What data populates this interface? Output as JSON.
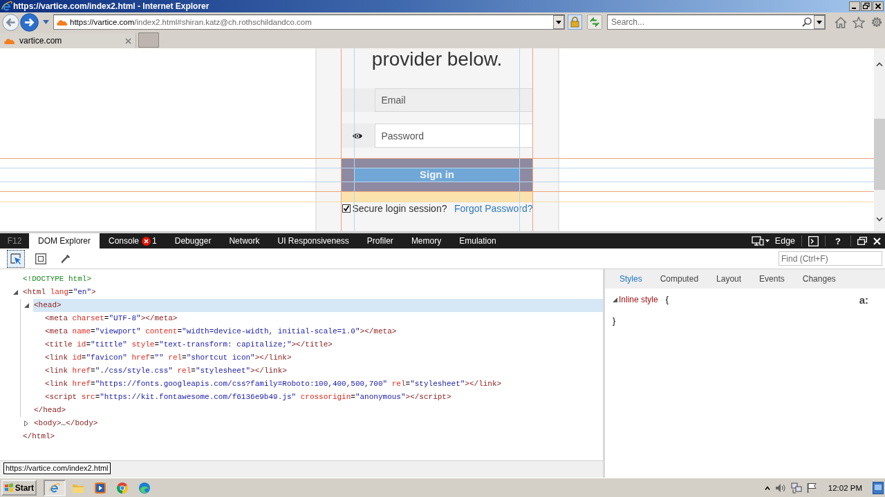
{
  "window": {
    "title": "https://vartice.com/index2.html - Internet Explorer"
  },
  "address_bar": {
    "url_host": "https://vartice.com",
    "url_path": "/index2.html#shiran.katz@ch.rothschildandco.com"
  },
  "search": {
    "placeholder": "Search..."
  },
  "tabs": [
    {
      "label": "vartice.com",
      "selected": true
    }
  ],
  "page": {
    "heading": "provider below.",
    "email": {
      "placeholder": "Email"
    },
    "password": {
      "placeholder": "Password"
    },
    "sign_in": "Sign in",
    "remember": {
      "label": "Secure login session?",
      "checked": true
    },
    "forgot_link": "Forgot Password?"
  },
  "devtools": {
    "f12": "F12",
    "tabs": [
      {
        "label": "DOM Explorer",
        "selected": true
      },
      {
        "label": "Console",
        "selected": false,
        "error_count": "1"
      },
      {
        "label": "Debugger",
        "selected": false
      },
      {
        "label": "Network",
        "selected": false
      },
      {
        "label": "UI Responsiveness",
        "selected": false
      },
      {
        "label": "Profiler",
        "selected": false
      },
      {
        "label": "Memory",
        "selected": false
      },
      {
        "label": "Emulation",
        "selected": false
      }
    ],
    "document_mode": "Edge",
    "help": "?",
    "tools": [
      {
        "kind": "select",
        "selected": true
      },
      {
        "kind": "box",
        "selected": false
      },
      {
        "kind": "eyedropper",
        "selected": false
      }
    ],
    "find": {
      "placeholder": "Find (Ctrl+F)"
    },
    "dom_tree": [
      {
        "tokens": [
          {
            "kind": "doctype",
            "text": "<!DOCTYPE html>"
          }
        ],
        "selected": false
      },
      {
        "tokens": [
          {
            "kind": "tag",
            "text": "<html"
          },
          {
            "kind": "attr",
            "text": " lang"
          },
          {
            "kind": "punct",
            "text": "="
          },
          {
            "kind": "value",
            "text": "\"en\""
          },
          {
            "kind": "tag",
            "text": ">"
          }
        ],
        "expanded": true,
        "selected": false,
        "children": [
          {
            "tokens": [
              {
                "kind": "tag",
                "text": "<head>"
              }
            ],
            "expanded": true,
            "selected": true,
            "children": [
              {
                "tokens": [
                  {
                    "kind": "tag",
                    "text": "<meta"
                  },
                  {
                    "kind": "attr",
                    "text": " charset"
                  },
                  {
                    "kind": "punct",
                    "text": "="
                  },
                  {
                    "kind": "value",
                    "text": "\"UTF-8\""
                  },
                  {
                    "kind": "tag",
                    "text": "></meta>"
                  }
                ],
                "selected": false
              },
              {
                "tokens": [
                  {
                    "kind": "tag",
                    "text": "<meta"
                  },
                  {
                    "kind": "attr",
                    "text": " name"
                  },
                  {
                    "kind": "punct",
                    "text": "="
                  },
                  {
                    "kind": "value",
                    "text": "\"viewport\""
                  },
                  {
                    "kind": "attr",
                    "text": " content"
                  },
                  {
                    "kind": "punct",
                    "text": "="
                  },
                  {
                    "kind": "value",
                    "text": "\"width=device-width, initial-scale=1.0\""
                  },
                  {
                    "kind": "tag",
                    "text": "></meta>"
                  }
                ],
                "selected": false
              },
              {
                "tokens": [
                  {
                    "kind": "tag",
                    "text": "<title"
                  },
                  {
                    "kind": "attr",
                    "text": " id"
                  },
                  {
                    "kind": "punct",
                    "text": "="
                  },
                  {
                    "kind": "value",
                    "text": "\"tittle\""
                  },
                  {
                    "kind": "attr",
                    "text": " style"
                  },
                  {
                    "kind": "punct",
                    "text": "="
                  },
                  {
                    "kind": "value",
                    "text": "\"text-transform: capitalize;\""
                  },
                  {
                    "kind": "tag",
                    "text": "></title>"
                  }
                ],
                "selected": false
              },
              {
                "tokens": [
                  {
                    "kind": "tag",
                    "text": "<link"
                  },
                  {
                    "kind": "attr",
                    "text": " id"
                  },
                  {
                    "kind": "punct",
                    "text": "="
                  },
                  {
                    "kind": "value",
                    "text": "\"favicon\""
                  },
                  {
                    "kind": "attr",
                    "text": " href"
                  },
                  {
                    "kind": "punct",
                    "text": "="
                  },
                  {
                    "kind": "value",
                    "text": "\"\""
                  },
                  {
                    "kind": "attr",
                    "text": " rel"
                  },
                  {
                    "kind": "punct",
                    "text": "="
                  },
                  {
                    "kind": "value",
                    "text": "\"shortcut icon\""
                  },
                  {
                    "kind": "tag",
                    "text": "></link>"
                  }
                ],
                "selected": false
              },
              {
                "tokens": [
                  {
                    "kind": "tag",
                    "text": "<link"
                  },
                  {
                    "kind": "attr",
                    "text": " href"
                  },
                  {
                    "kind": "punct",
                    "text": "="
                  },
                  {
                    "kind": "value",
                    "text": "\"./css/style.css\""
                  },
                  {
                    "kind": "attr",
                    "text": " rel"
                  },
                  {
                    "kind": "punct",
                    "text": "="
                  },
                  {
                    "kind": "value",
                    "text": "\"stylesheet\""
                  },
                  {
                    "kind": "tag",
                    "text": "></link>"
                  }
                ],
                "selected": false
              },
              {
                "tokens": [
                  {
                    "kind": "tag",
                    "text": "<link"
                  },
                  {
                    "kind": "attr",
                    "text": " href"
                  },
                  {
                    "kind": "punct",
                    "text": "="
                  },
                  {
                    "kind": "value",
                    "text": "\"https://fonts.googleapis.com/css?family=Roboto:100,400,500,700\""
                  },
                  {
                    "kind": "attr",
                    "text": " rel"
                  },
                  {
                    "kind": "punct",
                    "text": "="
                  },
                  {
                    "kind": "value",
                    "text": "\"stylesheet\""
                  },
                  {
                    "kind": "tag",
                    "text": "></link>"
                  }
                ],
                "selected": false
              },
              {
                "tokens": [
                  {
                    "kind": "tag",
                    "text": "<script"
                  },
                  {
                    "kind": "attr",
                    "text": " src"
                  },
                  {
                    "kind": "punct",
                    "text": "="
                  },
                  {
                    "kind": "value",
                    "text": "\"https://kit.fontawesome.com/f6136e9b49.js\""
                  },
                  {
                    "kind": "attr",
                    "text": " crossorigin"
                  },
                  {
                    "kind": "punct",
                    "text": "="
                  },
                  {
                    "kind": "value",
                    "text": "\"anonymous\""
                  },
                  {
                    "kind": "tag",
                    "text": "></script>"
                  }
                ],
                "selected": false
              }
            ],
            "closing_tokens": [
              {
                "kind": "tag",
                "text": "</head>"
              }
            ]
          },
          {
            "tokens": [
              {
                "kind": "tag",
                "text": "<body>"
              },
              {
                "kind": "text",
                "text": "…"
              },
              {
                "kind": "tag",
                "text": "</body>"
              }
            ],
            "expanded": false,
            "selected": false
          }
        ],
        "closing_tokens": [
          {
            "kind": "tag",
            "text": "</html>"
          }
        ]
      }
    ],
    "styles_pane": {
      "tabs": [
        {
          "label": "Styles",
          "selected": true
        },
        {
          "label": "Computed",
          "selected": false
        },
        {
          "label": "Layout",
          "selected": false
        },
        {
          "label": "Events",
          "selected": false
        },
        {
          "label": "Changes",
          "selected": false
        }
      ],
      "pseudo_toggle": "a:",
      "rules": [
        {
          "selector": "Inline style",
          "expanded": true,
          "open_brace": "{",
          "close_brace": "}"
        }
      ]
    }
  },
  "status_tooltip": "https://vartice.com/index2.html",
  "taskbar": {
    "start": "Start",
    "apps": [
      {
        "kind": "ie",
        "active": true
      },
      {
        "kind": "folder",
        "active": false
      },
      {
        "kind": "media",
        "active": false
      },
      {
        "kind": "chrome",
        "active": false
      },
      {
        "kind": "edge",
        "active": false
      }
    ],
    "clock": "12:02 PM"
  }
}
